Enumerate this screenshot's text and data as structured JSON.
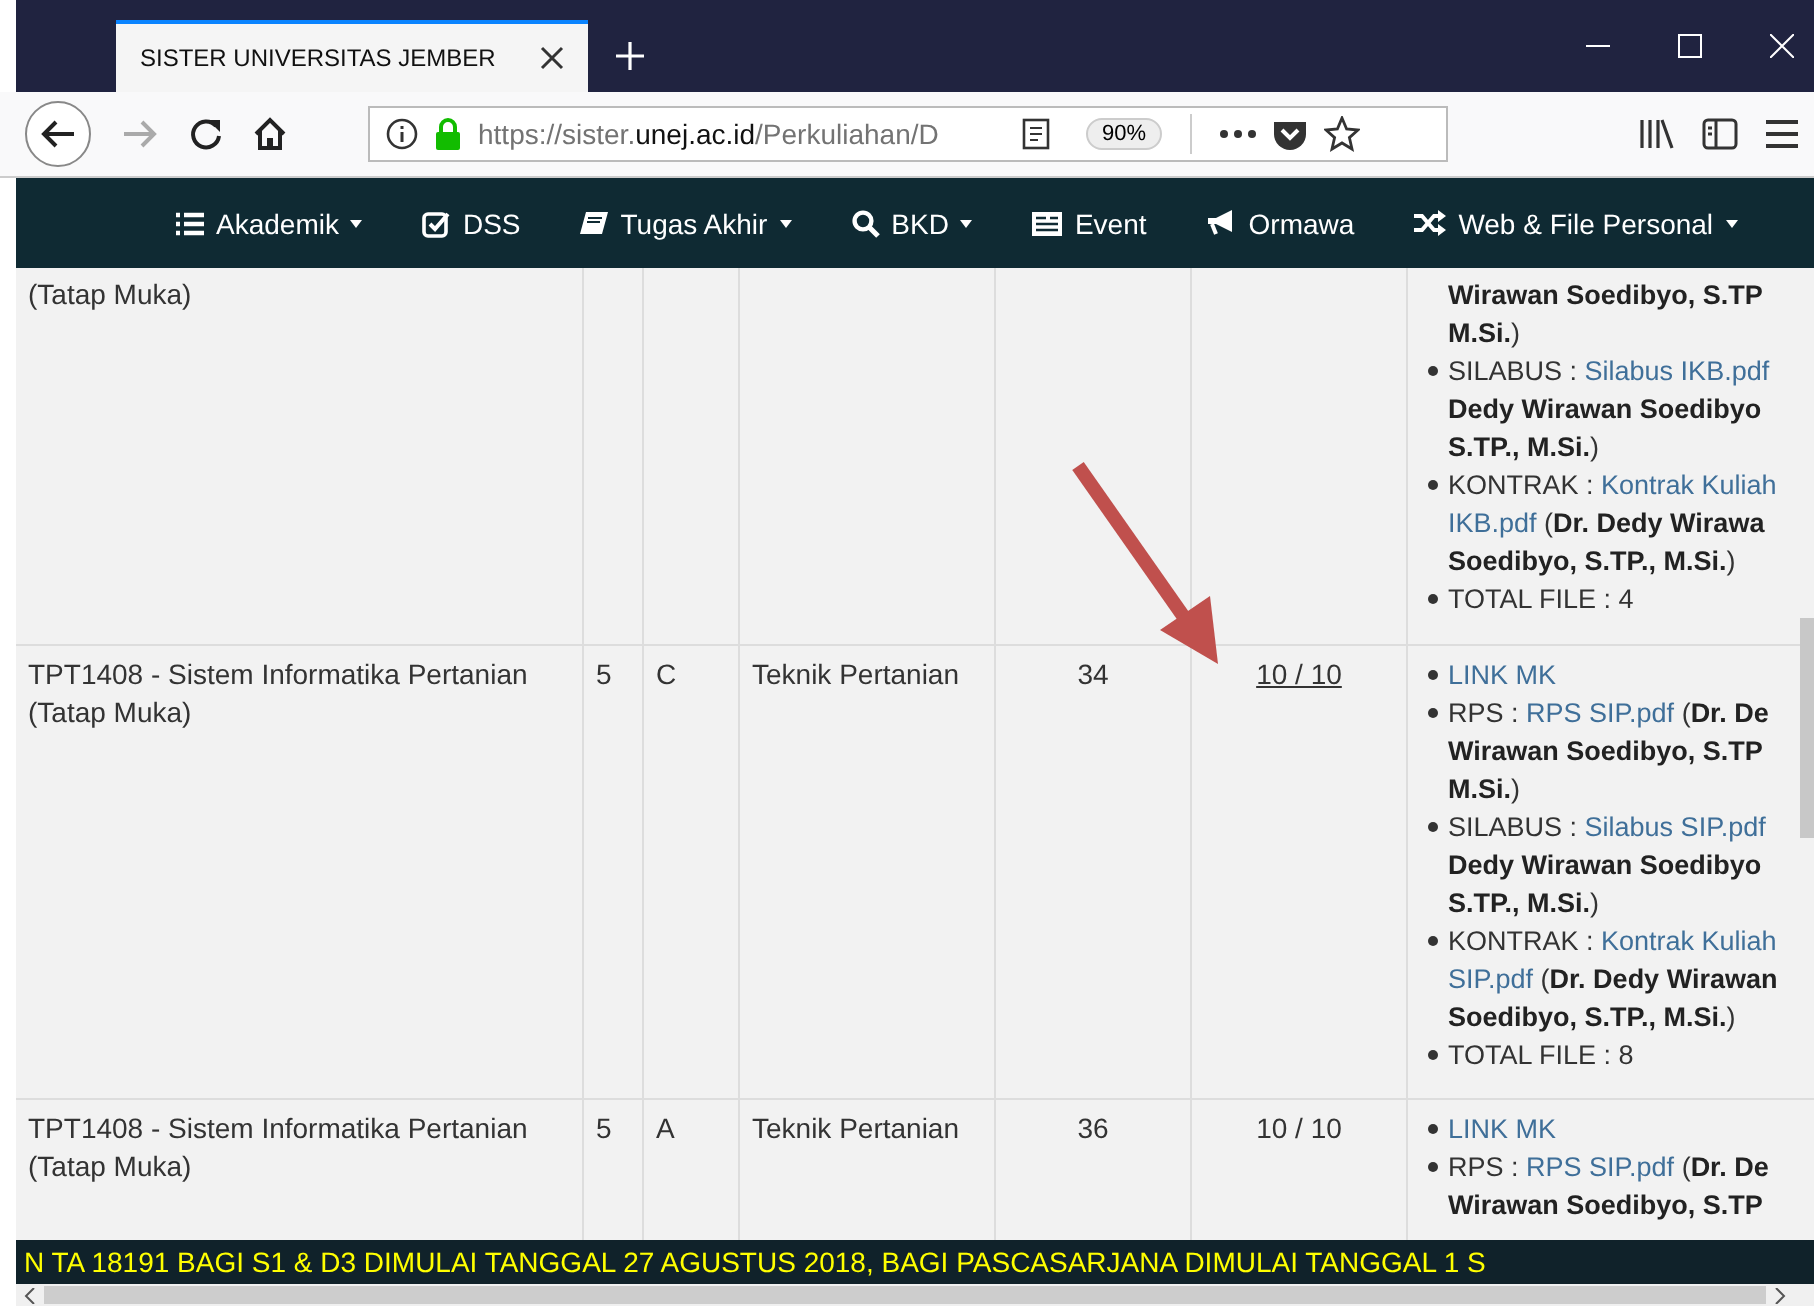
{
  "browser": {
    "tab_title": "SISTER UNIVERSITAS JEMBER",
    "address": {
      "url_dim": "https://sister.",
      "url_host": "unej.ac.id",
      "url_path": "/Perkuliahan/D"
    },
    "zoom": "90%"
  },
  "navbar": {
    "items": [
      {
        "label": "Akademik",
        "dropdown": true
      },
      {
        "label": "DSS",
        "dropdown": false
      },
      {
        "label": "Tugas Akhir",
        "dropdown": true
      },
      {
        "label": "BKD",
        "dropdown": true
      },
      {
        "label": "Event",
        "dropdown": false
      },
      {
        "label": "Ormawa",
        "dropdown": false
      },
      {
        "label": "Web & File Personal",
        "dropdown": true
      }
    ]
  },
  "table": {
    "rows": [
      {
        "course": "(Tatap Muka)",
        "files": [
          {
            "kind": "continuation",
            "lines": [
              [
                {
                  "text": "Wirawan Soedibyo, S.TP",
                  "kind": "bold"
                }
              ],
              [
                {
                  "text": "M.Si.",
                  "kind": "bold"
                },
                {
                  "text": ")",
                  "kind": "plain"
                }
              ]
            ]
          },
          {
            "kind": "item",
            "lines": [
              [
                {
                  "text": "SILABUS : ",
                  "kind": "plain"
                },
                {
                  "text": "Silabus IKB.pdf",
                  "kind": "link"
                }
              ],
              [
                {
                  "text": "Dedy Wirawan Soedibyo",
                  "kind": "bold"
                }
              ],
              [
                {
                  "text": "S.TP., M.Si.",
                  "kind": "bold"
                },
                {
                  "text": ")",
                  "kind": "plain"
                }
              ]
            ]
          },
          {
            "kind": "item",
            "lines": [
              [
                {
                  "text": "KONTRAK : ",
                  "kind": "plain"
                },
                {
                  "text": "Kontrak Kuliah",
                  "kind": "link"
                }
              ],
              [
                {
                  "text": "IKB.pdf",
                  "kind": "link"
                },
                {
                  "text": " (",
                  "kind": "plain"
                },
                {
                  "text": "Dr. Dedy Wirawa",
                  "kind": "bold"
                }
              ],
              [
                {
                  "text": "Soedibyo, S.TP., M.Si.",
                  "kind": "bold"
                },
                {
                  "text": ")",
                  "kind": "plain"
                }
              ]
            ]
          },
          {
            "kind": "item",
            "lines": [
              [
                {
                  "text": "TOTAL FILE : 4",
                  "kind": "plain"
                }
              ]
            ]
          }
        ]
      },
      {
        "course": "TPT1408 - Sistem Informatika Pertanian (Tatap Muka)",
        "sks": "5",
        "class": "C",
        "program": "Teknik Pertanian",
        "count": "34",
        "ratio": "10 / 10",
        "ratio_underlined": true,
        "files": [
          {
            "kind": "item",
            "lines": [
              [
                {
                  "text": "LINK MK",
                  "kind": "link"
                }
              ]
            ]
          },
          {
            "kind": "item",
            "lines": [
              [
                {
                  "text": "RPS : ",
                  "kind": "plain"
                },
                {
                  "text": "RPS SIP.pdf",
                  "kind": "link"
                },
                {
                  "text": " (",
                  "kind": "plain"
                },
                {
                  "text": "Dr. De",
                  "kind": "bold"
                }
              ],
              [
                {
                  "text": "Wirawan Soedibyo, S.TP",
                  "kind": "bold"
                }
              ],
              [
                {
                  "text": "M.Si.",
                  "kind": "bold"
                },
                {
                  "text": ")",
                  "kind": "plain"
                }
              ]
            ]
          },
          {
            "kind": "item",
            "lines": [
              [
                {
                  "text": "SILABUS : ",
                  "kind": "plain"
                },
                {
                  "text": "Silabus SIP.pdf",
                  "kind": "link"
                }
              ],
              [
                {
                  "text": "Dedy Wirawan Soedibyo",
                  "kind": "bold"
                }
              ],
              [
                {
                  "text": "S.TP., M.Si.",
                  "kind": "bold"
                },
                {
                  "text": ")",
                  "kind": "plain"
                }
              ]
            ]
          },
          {
            "kind": "item",
            "lines": [
              [
                {
                  "text": "KONTRAK : ",
                  "kind": "plain"
                },
                {
                  "text": "Kontrak Kuliah",
                  "kind": "link"
                }
              ],
              [
                {
                  "text": "SIP.pdf",
                  "kind": "link"
                },
                {
                  "text": " (",
                  "kind": "plain"
                },
                {
                  "text": "Dr. Dedy Wirawan",
                  "kind": "bold"
                }
              ],
              [
                {
                  "text": "Soedibyo, S.TP., M.Si.",
                  "kind": "bold"
                },
                {
                  "text": ")",
                  "kind": "plain"
                }
              ]
            ]
          },
          {
            "kind": "item",
            "lines": [
              [
                {
                  "text": "TOTAL FILE : 8",
                  "kind": "plain"
                }
              ]
            ]
          }
        ]
      },
      {
        "course": "TPT1408 - Sistem Informatika Pertanian (Tatap Muka)",
        "sks": "5",
        "class": "A",
        "program": "Teknik Pertanian",
        "count": "36",
        "ratio": "10 / 10",
        "ratio_underlined": false,
        "files": [
          {
            "kind": "item",
            "lines": [
              [
                {
                  "text": "LINK MK",
                  "kind": "link"
                }
              ]
            ]
          },
          {
            "kind": "item",
            "lines": [
              [
                {
                  "text": "RPS : ",
                  "kind": "plain"
                },
                {
                  "text": "RPS SIP.pdf",
                  "kind": "link"
                },
                {
                  "text": " (",
                  "kind": "plain"
                },
                {
                  "text": "Dr. De",
                  "kind": "bold"
                }
              ],
              [
                {
                  "text": "Wirawan Soedibyo, S.TP",
                  "kind": "bold"
                }
              ]
            ]
          }
        ]
      }
    ]
  },
  "marquee": "N TA 18191 BAGI S1 & D3 DIMULAI TANGGAL 27 AGUSTUS 2018, BAGI PASCASARJANA DIMULAI TANGGAL 1 S"
}
